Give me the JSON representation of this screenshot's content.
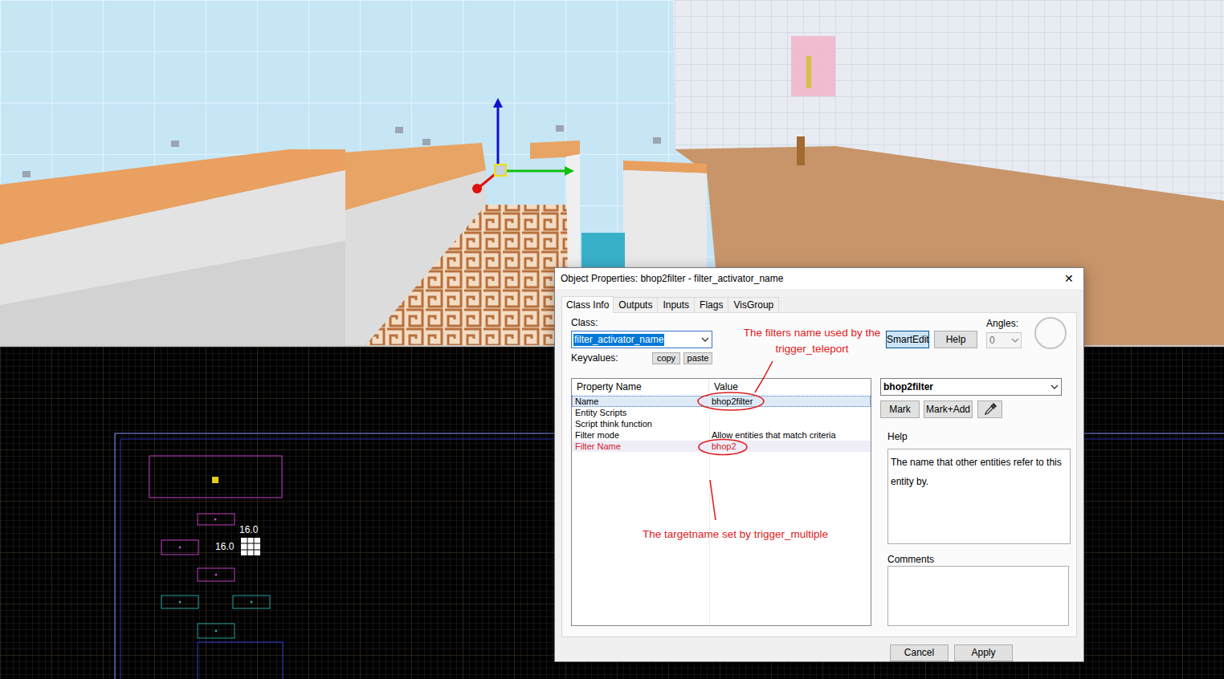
{
  "grid_view": {
    "dimensions": [
      {
        "text": "16.0"
      },
      {
        "text": "16.0"
      }
    ]
  },
  "dialog": {
    "title": "Object Properties: bhop2filter - filter_activator_name",
    "close": "✕",
    "tabs": [
      {
        "label": "Class Info",
        "selected": true
      },
      {
        "label": "Outputs",
        "selected": false
      },
      {
        "label": "Inputs",
        "selected": false
      },
      {
        "label": "Flags",
        "selected": false
      },
      {
        "label": "VisGroup",
        "selected": false
      }
    ],
    "class_label": "Class:",
    "class_value": {
      "text": "filter_activator_name",
      "highlighted": true
    },
    "keyvalues_label": "Keyvalues:",
    "copy_button": "copy",
    "paste_button": "paste",
    "smartedit": {
      "label": "SmartEdit",
      "pressed": true
    },
    "help_button": "Help",
    "angles": {
      "label": "Angles:",
      "value": "0"
    },
    "table": {
      "columns": [
        "Property Name",
        "Value"
      ],
      "rows": [
        {
          "property": "Name",
          "value": "bhop2filter",
          "selected": true,
          "modified": false
        },
        {
          "property": "Entity Scripts",
          "selected": false,
          "modified": false
        },
        {
          "property": "Script think function",
          "selected": false,
          "modified": false
        },
        {
          "property": "Filter mode",
          "value": "Allow entities that match criteria",
          "selected": false,
          "modified": false
        },
        {
          "property": "Filter Name",
          "value": "bhop2",
          "selected": false,
          "modified": true
        }
      ]
    },
    "entity_dropdown": "bhop2filter",
    "mark_buttons": [
      "Mark",
      "Mark+Add"
    ],
    "help": {
      "label": "Help",
      "text": "The name that other entities refer to this entity by."
    },
    "comments_label": "Comments",
    "footer_buttons": [
      "Cancel",
      "Apply"
    ]
  },
  "annotations": [
    {
      "text": "The filters name used by the trigger_teleport"
    },
    {
      "text": "The targetname set by trigger_multiple"
    }
  ]
}
